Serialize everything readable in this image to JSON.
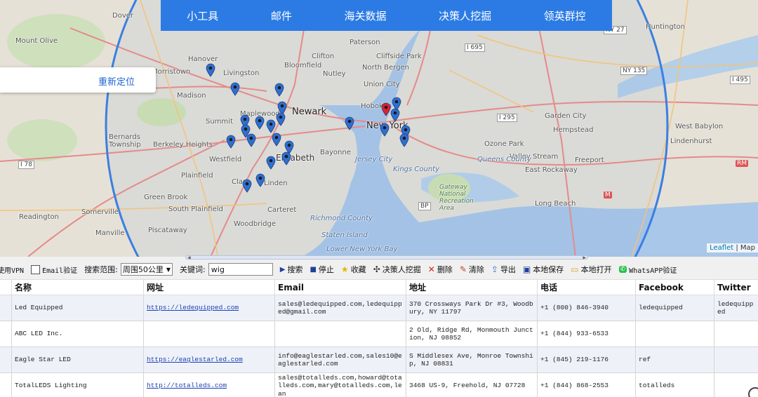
{
  "nav": {
    "items": [
      "小工具",
      "邮件",
      "海关数据",
      "决策人挖掘",
      "领英群控"
    ]
  },
  "relocate_label": "重新定位",
  "attribution": {
    "leaflet": "Leaflet",
    "sep": " | ",
    "map": "Map"
  },
  "map_labels": {
    "cities": [
      "Newark",
      "New York",
      "Elizabeth",
      "Hoboken"
    ],
    "towns": [
      "Dover",
      "Mount Olive",
      "Hanover",
      "Livingston",
      "Morristown",
      "Madison",
      "Maplewood",
      "Summit",
      "Bernards Township",
      "Berkeley Heights",
      "Westfield",
      "Plainfield",
      "Clark",
      "Linden",
      "Green Brook",
      "South Plainfield",
      "Somerville",
      "Readington",
      "Manville",
      "Piscataway",
      "Carteret",
      "Woodbridge",
      "Bayonne",
      "Jersey City",
      "Union City",
      "Clifton",
      "Paterson",
      "Bloomfield",
      "Nutley",
      "Cliffside Park",
      "North Bergen",
      "Garden City",
      "Hempstead",
      "West Babylon",
      "Lindenhurst",
      "Valley Stream",
      "Freeport",
      "East Rockaway",
      "Long Beach",
      "Huntington",
      "Queens County",
      "Kings County",
      "Richmond County",
      "Staten Island",
      "Lower New York Bay",
      "Ozone Park"
    ],
    "parks": [
      "Gateway National Recreation Area"
    ],
    "roads": [
      "I 695",
      "I 78",
      "I 295",
      "NY 135",
      "NY 27",
      "BP",
      "M",
      "RM",
      "I 495"
    ]
  },
  "toolbar": {
    "vpn_label": "使用VPN",
    "email_verify_label": "Email验证",
    "scope_label": "搜索范围:",
    "scope_value": "周围50公里",
    "keyword_label": "关键词:",
    "keyword_value": "wig",
    "search": "搜索",
    "stop": "停止",
    "favorite": "收藏",
    "decision_maker": "决策人挖掘",
    "delete": "删除",
    "clear": "清除",
    "export": "导出",
    "save_local": "本地保存",
    "open_local": "本地打开",
    "whatsapp_verify": "WhatsAPP验证"
  },
  "table": {
    "columns": [
      "",
      "名称",
      "网址",
      "Email",
      "地址",
      "电话",
      "Facebook",
      "Twitter"
    ],
    "rows": [
      {
        "name": "Led Equipped",
        "url": "https://ledequipped.com",
        "email": "sales@ledequipped.com,ledequipped@gmail.com",
        "address": "370 Crossways Park Dr #3, Woodbury, NY 11797",
        "phone": "+1 (800) 846-3940",
        "facebook": "ledequipped",
        "twitter": "ledequipped"
      },
      {
        "name": "ABC LED Inc.",
        "url": "",
        "email": "",
        "address": "2 Old, Ridge Rd, Monmouth Junction, NJ 08852",
        "phone": "+1 (844) 933-6533",
        "facebook": "",
        "twitter": ""
      },
      {
        "name": "Eagle Star LED",
        "url": "https://eaglestarled.com",
        "email": "info@eaglestarled.com,sales10@eaglestarled.com",
        "address": "S Middlesex Ave, Monroe Township, NJ 08831",
        "phone": "+1 (845) 219-1176",
        "facebook": "ref",
        "twitter": ""
      },
      {
        "name": "TotalLEDS Lighting",
        "url": "http://totalleds.com",
        "email": "sales@totalleds.com,howard@totalleds.com,mary@totalleds.com,lean",
        "address": "3468 US-9, Freehold, NJ 07728",
        "phone": "+1 (844) 868-2553",
        "facebook": "totalleds",
        "twitter": ""
      }
    ]
  },
  "colors": {
    "nav_bg": "#2c7be5",
    "radius_circle": "#3b7fe0",
    "pin_blue": "#2f6fd0",
    "pin_red": "#e0202a",
    "link": "#1a3fb5"
  }
}
